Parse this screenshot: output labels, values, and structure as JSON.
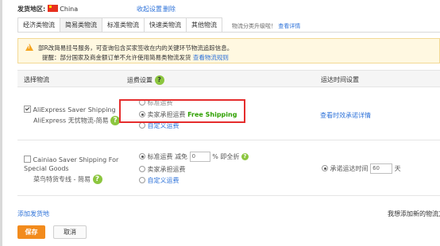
{
  "top": {
    "region_label": "发货地区:",
    "country": "China",
    "collapse_settings": "收起设置",
    "delete": "删除"
  },
  "tabs": [
    {
      "label": "经济类物流"
    },
    {
      "label": "简易类物流",
      "active": true
    },
    {
      "label": "标准类物流"
    },
    {
      "label": "快速类物流"
    },
    {
      "label": "其他物流"
    }
  ],
  "tab_hint": {
    "text": "物流分类升级啦！",
    "link": "查看详情"
  },
  "notice": {
    "line1": "部R改简易挂号服务，可查询包含买家签收在内的关键环节物流追踪信息。",
    "line2_prefix": "提醒：部分国家及商金额订单不允许使用简易类物流发货 ",
    "line2_link": "查看物流规则"
  },
  "table_head": {
    "col1": "选择物流",
    "col2": "运费设置",
    "col3": "运达时间设置"
  },
  "row1": {
    "name_en": "AliExpress Saver Shipping",
    "name_cn": "AliExpress 无忧物流-简易",
    "opt_standard": "标准运费",
    "opt_seller": "卖家承担运费",
    "free_shipping": "Free Shipping",
    "opt_custom": "自定义运费",
    "time_link": "查看时效承诺详情"
  },
  "row2": {
    "name_en_1": "Cainiao Saver Shipping For",
    "name_en_2": "Special Goods",
    "name_cn": "菜鸟特货专线 - 简易",
    "opt_standard": "标准运费",
    "discount_label": "减免",
    "discount_value": "0",
    "discount_suffix": "% 即全折",
    "opt_seller": "卖家承担运费",
    "opt_custom": "自定义运费",
    "time_label": "承诺运达时间",
    "time_value": "60",
    "time_unit": "天"
  },
  "footer": {
    "add_location": "添加发货地",
    "right_hint": "我想添加新的物流方",
    "save": "保存",
    "cancel": "取消"
  }
}
